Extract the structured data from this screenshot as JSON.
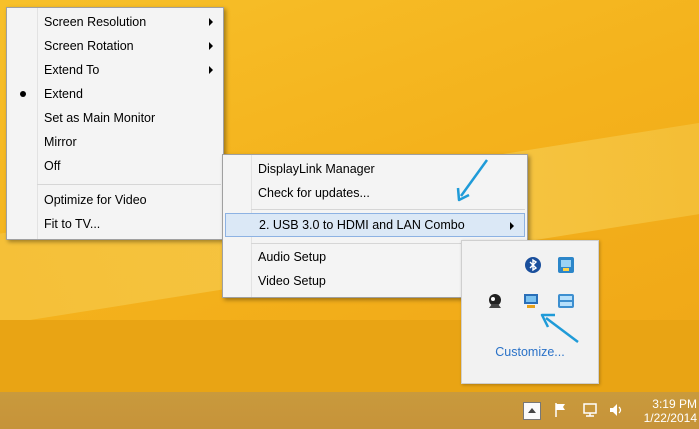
{
  "context_menu": {
    "items": [
      {
        "label": "Screen Resolution",
        "submenu": true
      },
      {
        "label": "Screen Rotation",
        "submenu": true
      },
      {
        "label": "Extend To",
        "submenu": true
      },
      {
        "label": "Extend",
        "checked": true
      },
      {
        "label": "Set as Main Monitor"
      },
      {
        "label": "Mirror"
      },
      {
        "label": "Off"
      },
      {
        "label": "Optimize for Video"
      },
      {
        "label": "Fit to TV..."
      }
    ]
  },
  "displaylink_menu": {
    "items": [
      {
        "label": "DisplayLink Manager"
      },
      {
        "label": "Check for updates..."
      },
      {
        "label": "2. USB 3.0 to HDMI and LAN Combo",
        "submenu": true,
        "highlighted": true
      },
      {
        "label": "Audio Setup"
      },
      {
        "label": "Video Setup"
      }
    ]
  },
  "tray_overflow": {
    "customize_label": "Customize..."
  },
  "taskbar": {
    "time": "3:19 PM",
    "date": "1/22/2014"
  },
  "colors": {
    "menu_highlight": "#dbe8f6",
    "link": "#2a72c8",
    "annotation_arrow": "#1f9bd8"
  }
}
